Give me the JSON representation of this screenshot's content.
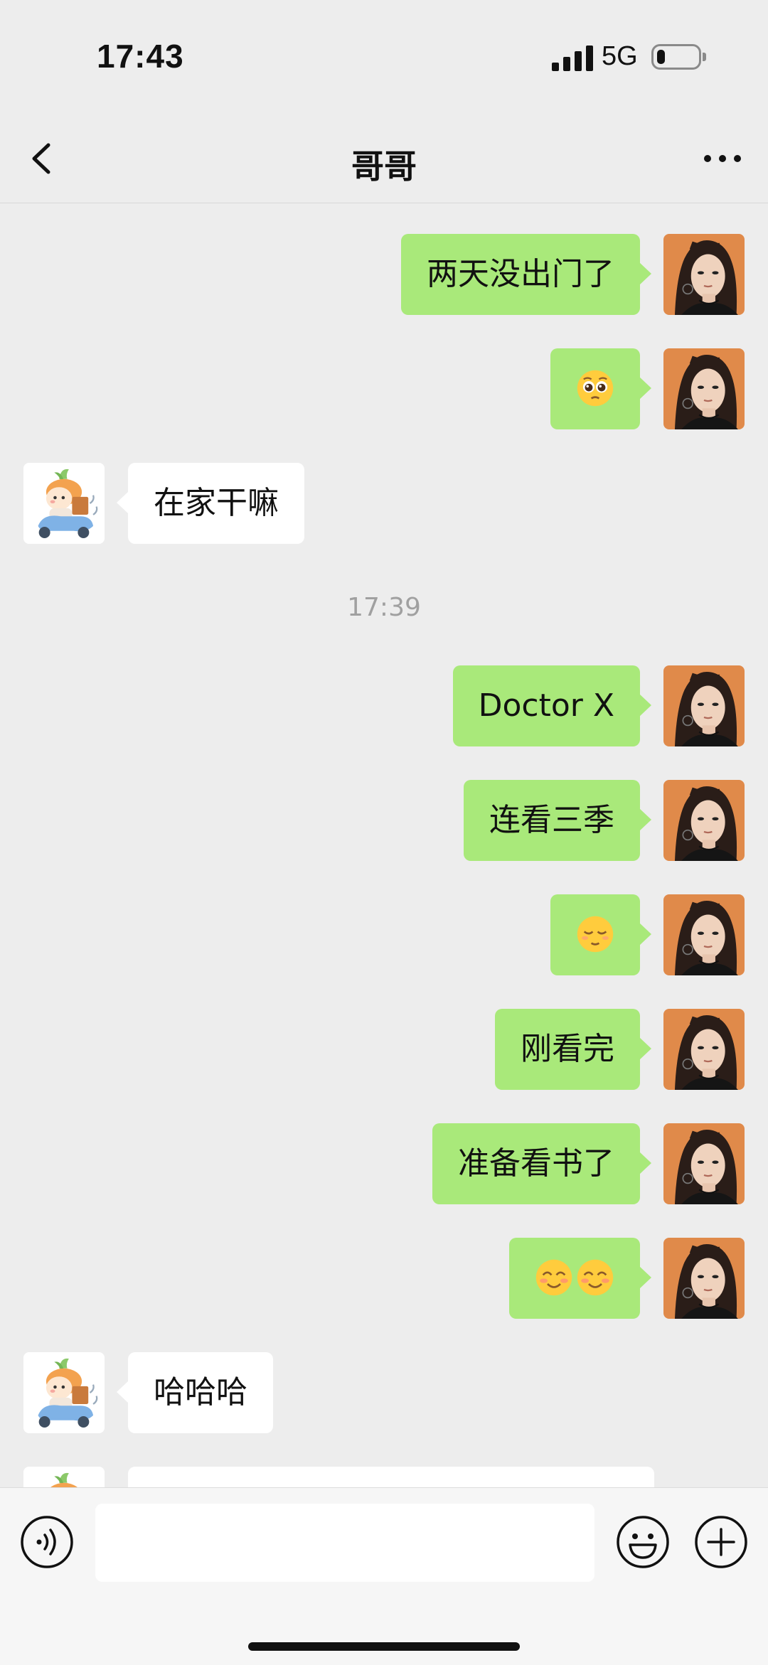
{
  "status_bar": {
    "time": "17:43",
    "network": "5G",
    "battery_level": 0.2
  },
  "header": {
    "title": "哥哥"
  },
  "timestamp": "17:39",
  "messages": [
    {
      "sender": "me",
      "text": "两天没出门了"
    },
    {
      "sender": "me",
      "emoji": [
        "pleading-face"
      ]
    },
    {
      "sender": "other",
      "text": "在家干嘛"
    },
    {
      "sender": "me",
      "text": "Doctor X"
    },
    {
      "sender": "me",
      "text": "连看三季"
    },
    {
      "sender": "me",
      "emoji": [
        "relieved-face"
      ]
    },
    {
      "sender": "me",
      "text": "刚看完"
    },
    {
      "sender": "me",
      "text": "准备看书了"
    },
    {
      "sender": "me",
      "emoji": [
        "smiling-face",
        "smiling-face"
      ]
    },
    {
      "sender": "other",
      "text": "哈哈哈"
    }
  ],
  "input": {
    "value": ""
  },
  "colors": {
    "my_bubble": "#a9e97a",
    "other_bubble": "#ffffff",
    "background": "#ededed"
  }
}
